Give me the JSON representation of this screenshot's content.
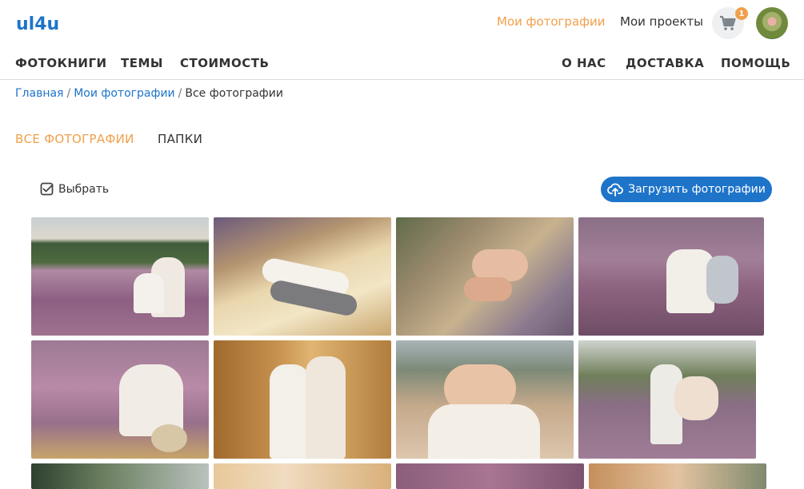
{
  "header": {
    "logo_text": "ul4u",
    "links": [
      {
        "label": "Мои фотографии",
        "active": true
      },
      {
        "label": "Мои проекты",
        "active": false
      }
    ],
    "cart_count": "1",
    "accent_color": "#f0a04b",
    "link_color": "#1e74c9"
  },
  "nav": {
    "left": [
      "ФОТОКНИГИ",
      "ТЕМЫ",
      "СТОИМОСТЬ"
    ],
    "right": [
      "О НАС",
      "ДОСТАВКА",
      "ПОМОЩЬ"
    ]
  },
  "breadcrumb": [
    "Главная",
    "Мои фотографии",
    "Все фотографии"
  ],
  "tabs": [
    {
      "label": "ВСЕ ФОТОГРАФИИ",
      "active": true
    },
    {
      "label": "ПАПКИ",
      "active": false
    }
  ],
  "toolbar": {
    "select_label": "Выбрать",
    "upload_label": "Загрузить фотографии"
  }
}
